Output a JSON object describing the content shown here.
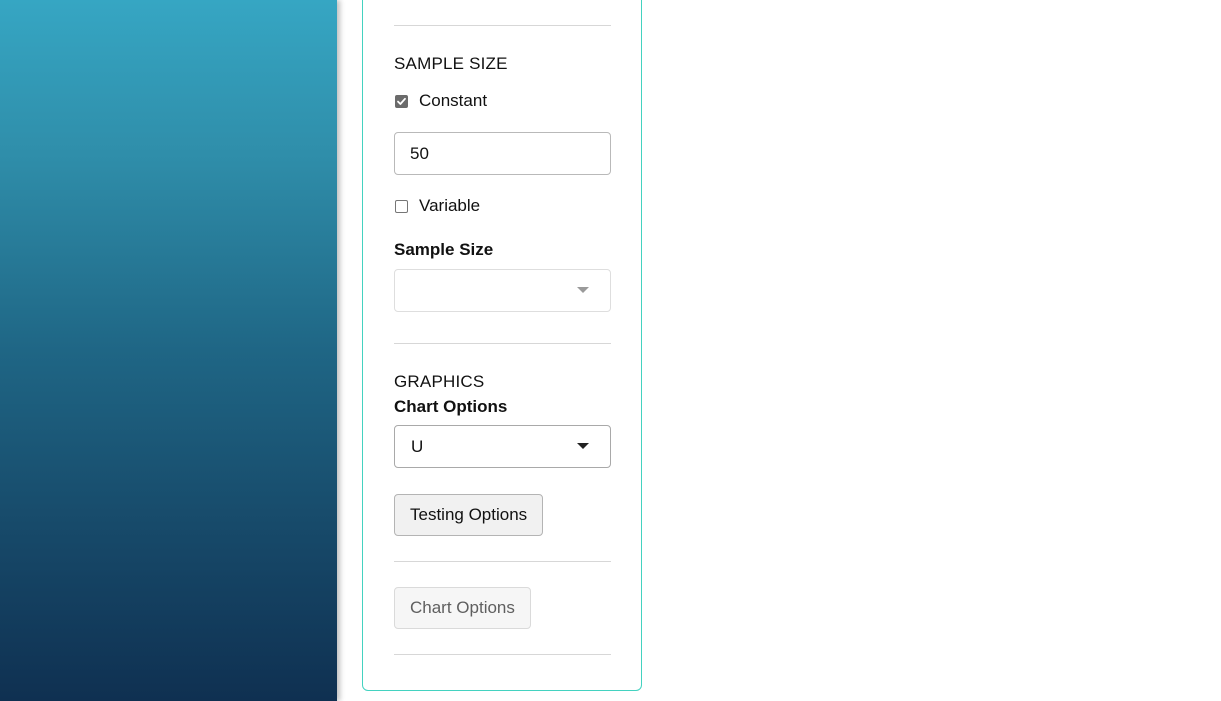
{
  "colors": {
    "panel_border": "#43d2c0",
    "sidebar_top": "#36a6c3",
    "sidebar_bottom": "#0f3051"
  },
  "sample_size": {
    "section_title": "SAMPLE SIZE",
    "constant": {
      "label": "Constant",
      "checked": true
    },
    "constant_value": "50",
    "variable": {
      "label": "Variable",
      "checked": false
    },
    "field_label": "Sample Size",
    "select_value": ""
  },
  "graphics": {
    "section_title": "GRAPHICS",
    "chart_options_label": "Chart Options",
    "chart_options_value": "U",
    "testing_options_button": "Testing Options",
    "chart_options_button": "Chart Options"
  },
  "icons": {
    "checkmark": "checkmark-icon",
    "dropdown": "chevron-down-icon"
  }
}
